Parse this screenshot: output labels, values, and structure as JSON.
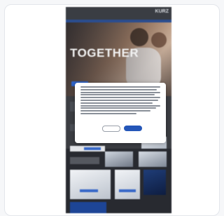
{
  "site": {
    "brand_text": "",
    "logo": "KURZ"
  },
  "hero": {
    "headline": "TOGETHER"
  },
  "cookie_dialog": {
    "decline_label": "",
    "accept_label": ""
  }
}
